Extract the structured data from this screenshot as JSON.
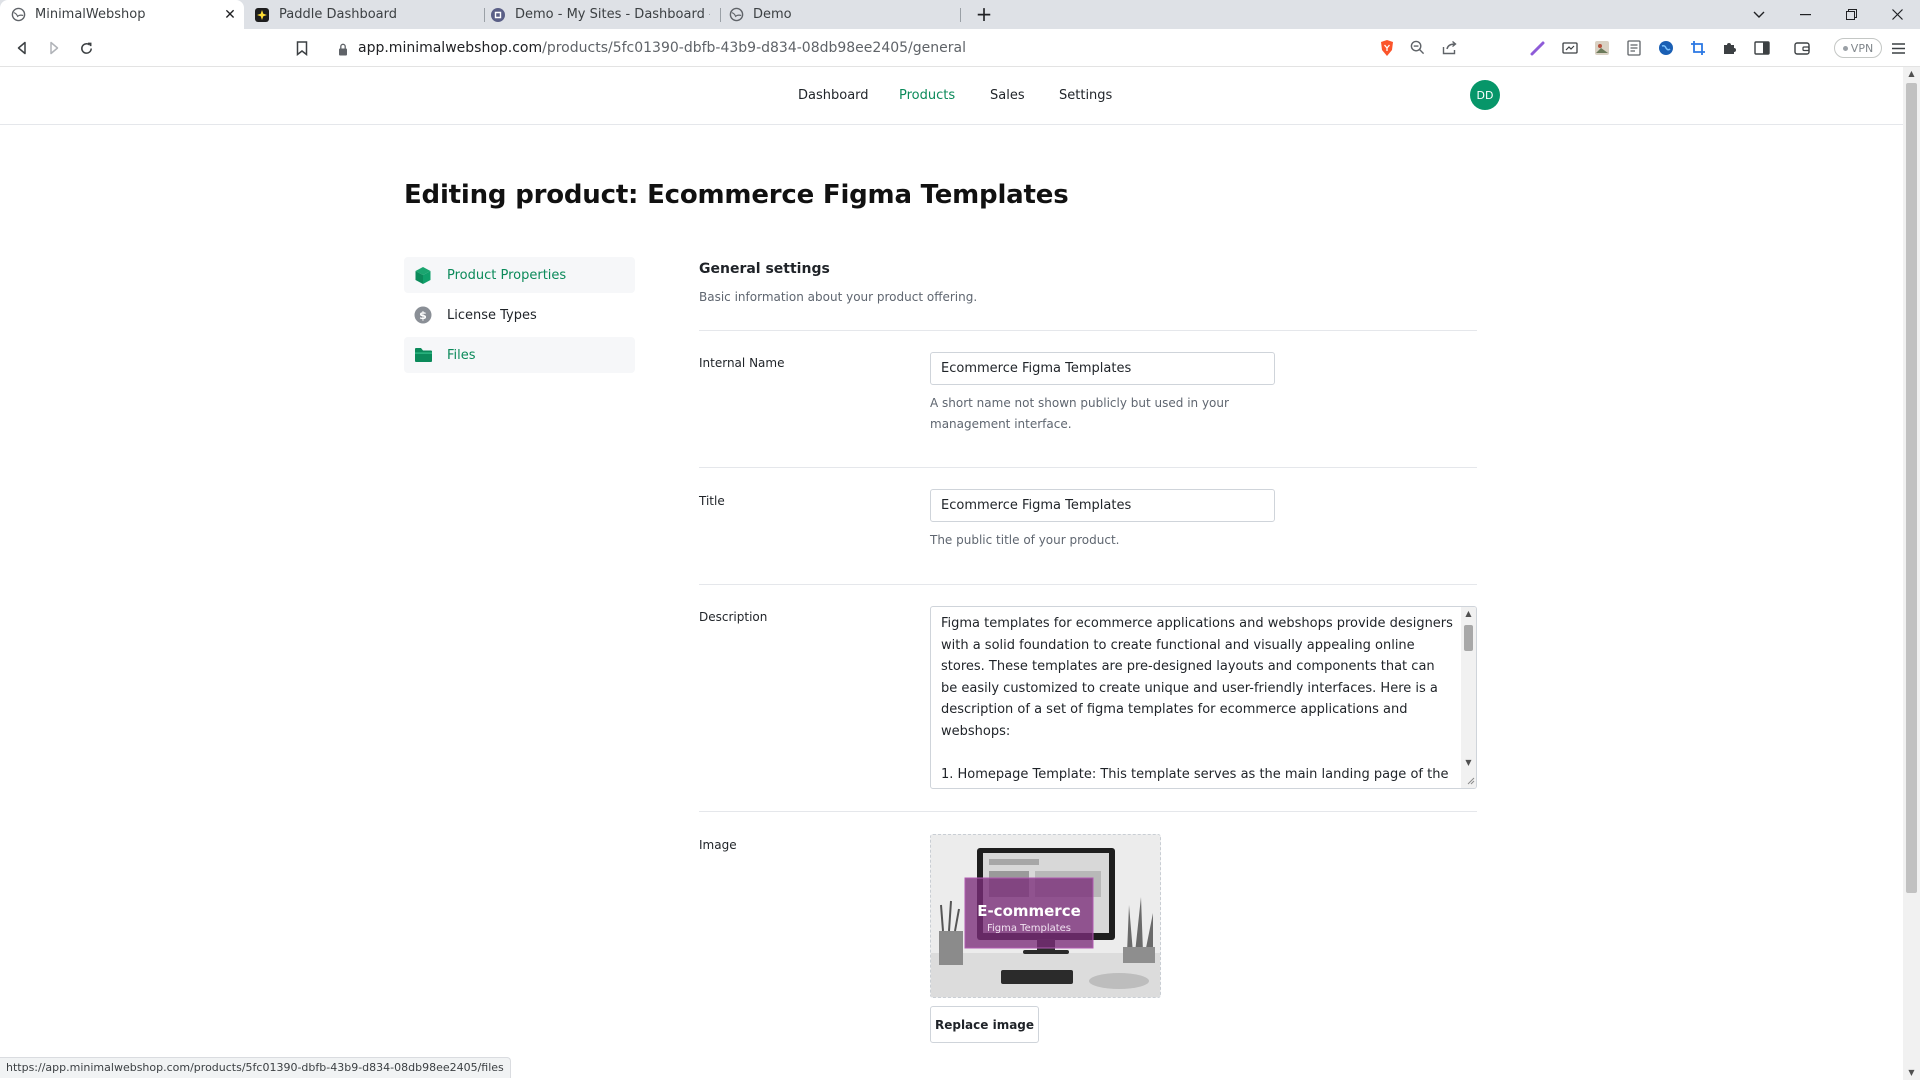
{
  "browser": {
    "tabs": [
      {
        "title": "MinimalWebshop",
        "active": true,
        "favicon": "globe-icon"
      },
      {
        "title": "Paddle Dashboard",
        "active": false,
        "favicon": "paddle-icon"
      },
      {
        "title": "Demo - My Sites - Dashboard - Carrd",
        "active": false,
        "favicon": "carrd-icon"
      },
      {
        "title": "Demo",
        "active": false,
        "favicon": "globe-icon"
      }
    ],
    "url_host": "app.minimalwebshop.com",
    "url_path": "/products/5fc01390-dbfb-43b9-d834-08db98ee2405/general",
    "vpn_label": "VPN",
    "status_url": "https://app.minimalwebshop.com/products/5fc01390-dbfb-43b9-d834-08db98ee2405/files"
  },
  "nav": {
    "items": [
      {
        "label": "Dashboard",
        "active": false
      },
      {
        "label": "Products",
        "active": true
      },
      {
        "label": "Sales",
        "active": false
      },
      {
        "label": "Settings",
        "active": false
      }
    ],
    "avatar_initials": "DD",
    "accent_color": "#0b8a5a"
  },
  "page": {
    "title": "Editing product: Ecommerce Figma Templates"
  },
  "sidebar": {
    "items": [
      {
        "label": "Product Properties",
        "icon": "cube-icon",
        "selected": true
      },
      {
        "label": "License Types",
        "icon": "dollar-icon",
        "selected": false
      },
      {
        "label": "Files",
        "icon": "folder-icon",
        "selected": true
      }
    ]
  },
  "general": {
    "title": "General settings",
    "subtitle": "Basic information about your product offering."
  },
  "fields": {
    "internal_name": {
      "label": "Internal Name",
      "value": "Ecommerce Figma Templates",
      "help": "A short name not shown publicly but used in your management interface."
    },
    "title": {
      "label": "Title",
      "value": "Ecommerce Figma Templates",
      "help": "The public title of your product."
    },
    "description": {
      "label": "Description",
      "value": "Figma templates for ecommerce applications and webshops provide designers with a solid foundation to create functional and visually appealing online stores. These templates are pre-designed layouts and components that can be easily customized to create unique and user-friendly interfaces. Here is a description of a set of figma templates for ecommerce applications and webshops:\n\n1. Homepage Template: This template serves as the main landing page of the"
    },
    "image": {
      "label": "Image",
      "overlay_title": "E-commerce",
      "overlay_subtitle": "Figma Templates",
      "replace_label": "Replace image"
    }
  }
}
